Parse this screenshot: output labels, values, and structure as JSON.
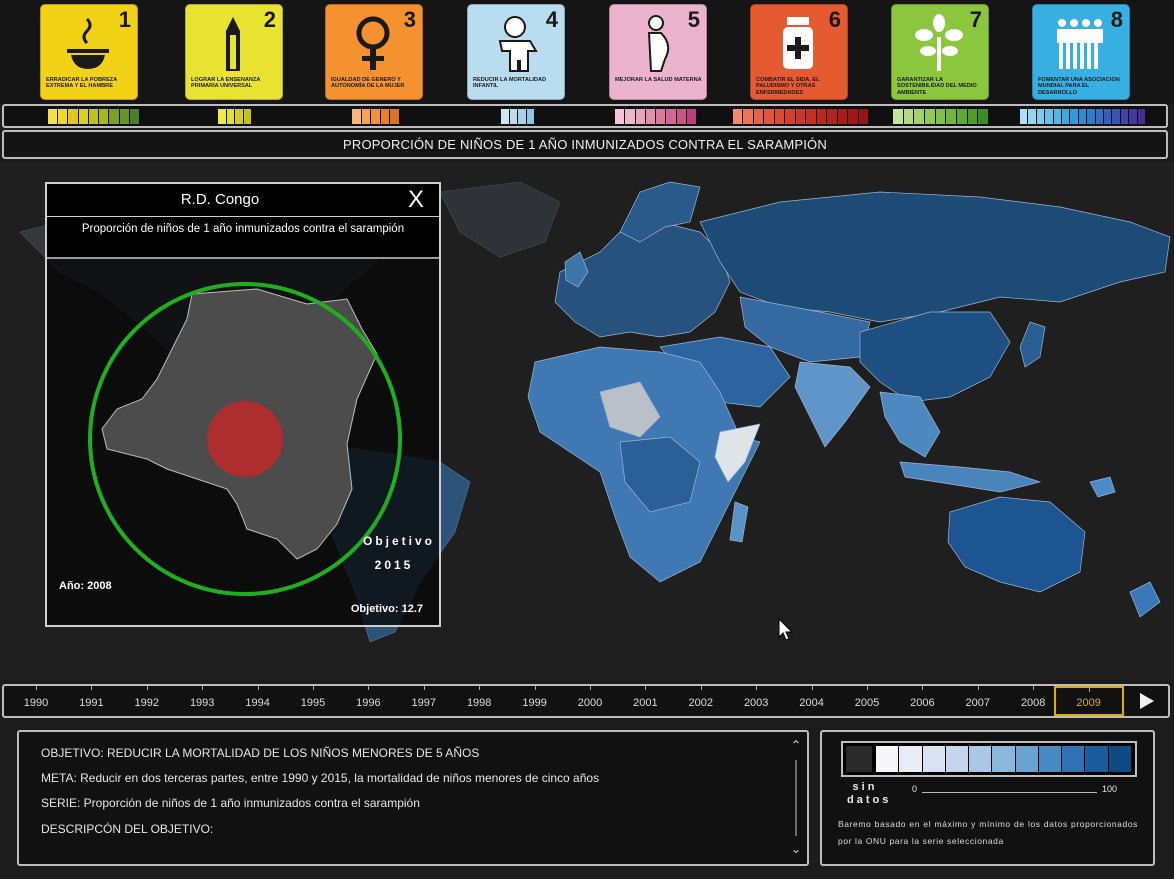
{
  "goals": [
    {
      "number": "1",
      "caption": "Erradicar la pobreza extrema y el hambre",
      "icon": "bowl-icon",
      "color": "#f2d216"
    },
    {
      "number": "2",
      "caption": "Lograr la enseñanza primaria universal",
      "icon": "pencil-icon",
      "color": "#e7e330"
    },
    {
      "number": "3",
      "caption": "Igualdad de género y autonomía de la mujer",
      "icon": "female-symbol-icon",
      "color": "#f3922e"
    },
    {
      "number": "4",
      "caption": "Reducir la mortalidad infantil",
      "icon": "child-icon",
      "color": "#b9dcee"
    },
    {
      "number": "5",
      "caption": "Mejorar la salud materna",
      "icon": "pregnant-woman-icon",
      "color": "#ecb3cd"
    },
    {
      "number": "6",
      "caption": "Combatir el SIDA, el paludismo y otras enfermedades",
      "icon": "medicine-jar-icon",
      "color": "#e65a31"
    },
    {
      "number": "7",
      "caption": "Garantizar la sostenibilidad del medio ambiente",
      "icon": "plant-icon",
      "color": "#8cc63f"
    },
    {
      "number": "8",
      "caption": "Fomentar una asociación mundial para el desarrollo",
      "icon": "people-group-icon",
      "color": "#37afe3"
    }
  ],
  "stripe_colors": [
    [
      "#f6e04a",
      "#f1d62a",
      "#e3c61c",
      "#d9d021",
      "#b9c41f",
      "#a6b81d",
      "#7ea027",
      "#66962a",
      "#4c7d2a"
    ],
    [
      "#ecea4a",
      "#e2e12a",
      "#d1d01e",
      "#c2c41a"
    ],
    [
      "#f8b77a",
      "#f5a456",
      "#f2923a",
      "#e78227",
      "#db7420"
    ],
    [
      "#cfe7f3",
      "#bcdced",
      "#a8d0e7",
      "#93c4e0"
    ],
    [
      "#f2c6d8",
      "#eeb6cb",
      "#e9a3bd",
      "#e28eaf",
      "#da7aa0",
      "#d36795",
      "#c95486",
      "#bf3f78"
    ],
    [
      "#f08a68",
      "#ec7654",
      "#e76447",
      "#e2553b",
      "#dc4a33",
      "#d4402d",
      "#cc3729",
      "#c42f25",
      "#bb2822",
      "#b2221f",
      "#a91c1c",
      "#a01818",
      "#961515"
    ],
    [
      "#c4e39a",
      "#b5da83",
      "#a4d26b",
      "#93c957",
      "#82c047",
      "#72b63b",
      "#61a932",
      "#4f9b2c",
      "#3f8c27"
    ],
    [
      "#a9dff5",
      "#93d6f2",
      "#7ccdee",
      "#66c2ea",
      "#52b6e6",
      "#3eaae2",
      "#2f9cdc",
      "#2a8dd5",
      "#2b7ecd",
      "#2f6fc5",
      "#3460bc",
      "#3a52b2",
      "#3f44a8",
      "#4537a0",
      "#4a2b96"
    ]
  ],
  "series_title": "PROPORCIÓN DE NIÑOS DE 1 AÑO INMUNIZADOS CONTRA EL SARAMPIÓN",
  "popup": {
    "country": "R.D. Congo",
    "close_label": "X",
    "subtitle": "Proporción de niños de 1 año inmunizados contra el sarampión",
    "objective_label": "Objetivo",
    "objective_year": "2015",
    "year_label": "Año: 2008",
    "objective_value": "Objetivo: 12.7"
  },
  "timeline": {
    "years": [
      "1990",
      "1991",
      "1992",
      "1993",
      "1994",
      "1995",
      "1996",
      "1997",
      "1998",
      "1999",
      "2000",
      "2001",
      "2002",
      "2003",
      "2004",
      "2005",
      "2006",
      "2007",
      "2008",
      "2009"
    ],
    "selected": "2009",
    "play_icon": "play-icon"
  },
  "info": {
    "objective": "OBJETIVO:  REDUCIR LA MORTALIDAD DE LOS NIÑOS MENORES DE 5 AÑOS",
    "meta": "META:  Reducir en dos terceras partes, entre 1990 y 2015, la mortalidad de niños menores de cinco años",
    "serie": "SERIE:  Proporción de niños de 1 año inmunizados contra el sarampión",
    "description": "DESCRIPCÓN DEL OBJETIVO:"
  },
  "legend": {
    "no_data": "sin datos",
    "min": "0",
    "max": "100",
    "note": "Baremo basado en el máximo y mínimo de los datos proporcionados por la ONU para la serie seleccionada",
    "colors": [
      "#2a2a2a",
      "#f7f7fb",
      "#eaedf6",
      "#d8e2f1",
      "#c3d6ec",
      "#a9c8e5",
      "#8ab7dc",
      "#6aa2d1",
      "#4a8ac4",
      "#2f72b3",
      "#1b5c9e",
      "#0f4a85"
    ]
  },
  "colors": {
    "selected_year": "#d8b000",
    "target_circle": "#1fae1f",
    "current_value": "#c0282a"
  }
}
